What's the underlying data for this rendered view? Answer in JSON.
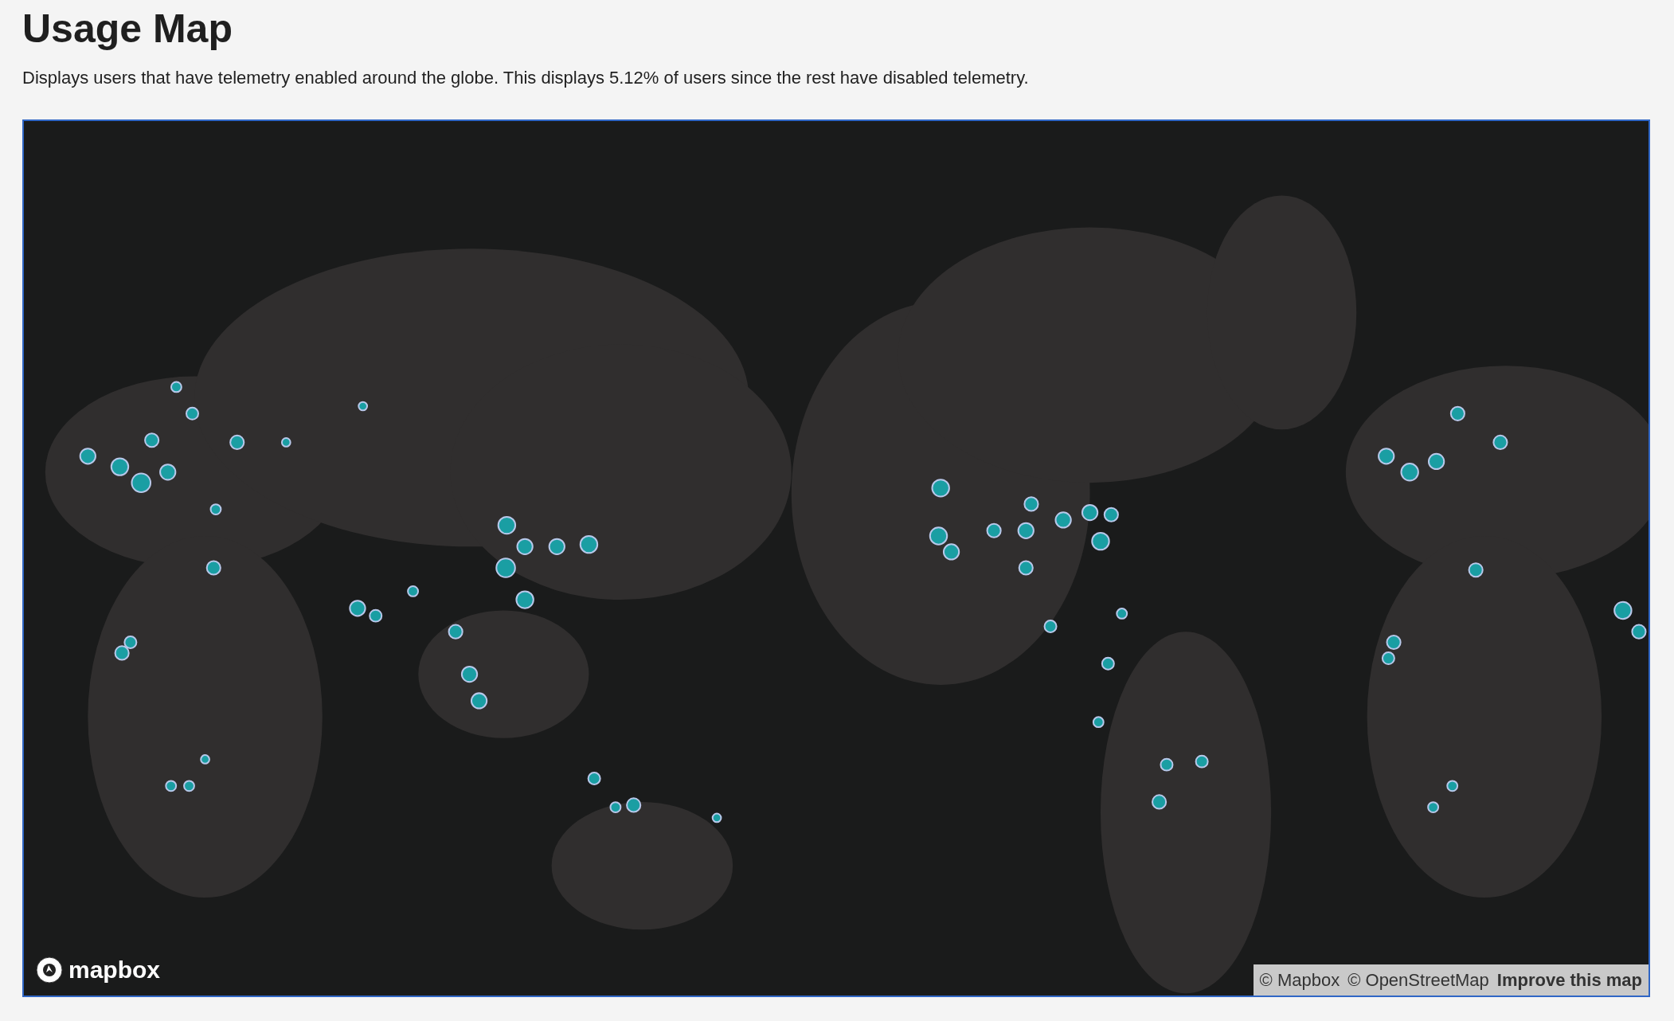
{
  "title": "Usage Map",
  "description": "Displays users that have telemetry enabled around the globe. This displays 5.12% of users since the rest have disabled telemetry.",
  "map": {
    "logo": "mapbox",
    "attribution": [
      {
        "kind": "text",
        "text": "© Mapbox"
      },
      {
        "kind": "text",
        "text": "© OpenStreetMap"
      },
      {
        "kind": "link",
        "text": "Improve this map"
      }
    ]
  }
}
